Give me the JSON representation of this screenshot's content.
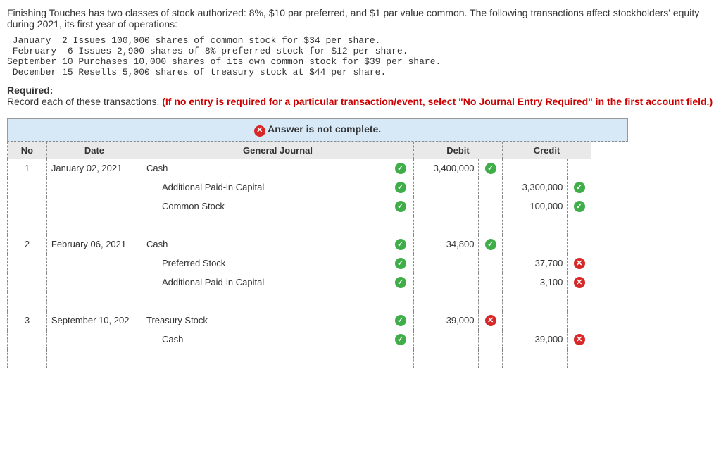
{
  "intro": "Finishing Touches has two classes of stock authorized: 8%, $10 par preferred, and $1 par value common. The following transactions affect stockholders' equity during 2021, its first year of operations:",
  "mono": " January  2 Issues 100,000 shares of common stock for $34 per share.\n February  6 Issues 2,900 shares of 8% preferred stock for $12 per share.\nSeptember 10 Purchases 10,000 shares of its own common stock for $39 per share.\n December 15 Resells 5,000 shares of treasury stock at $44 per share.",
  "required_label": "Required:",
  "required_text": "Record each of these transactions. ",
  "required_red": "(If no entry is required for a particular transaction/event, select \"No Journal Entry Required\" in the first account field.)",
  "banner": "Answer is not complete.",
  "banner_icon_alt": "✕",
  "th": {
    "no": "No",
    "date": "Date",
    "gj": "General Journal",
    "debit": "Debit",
    "credit": "Credit"
  },
  "rows": [
    {
      "no": "1",
      "date": "January 02, 2021",
      "acct": "Cash",
      "acct_ok": true,
      "debit": "3,400,000",
      "debit_ok": true,
      "credit": "",
      "credit_ok": null,
      "indent": false
    },
    {
      "no": "",
      "date": "",
      "acct": "Additional Paid-in Capital",
      "acct_ok": true,
      "debit": "",
      "debit_ok": null,
      "credit": "3,300,000",
      "credit_ok": true,
      "indent": true
    },
    {
      "no": "",
      "date": "",
      "acct": "Common Stock",
      "acct_ok": true,
      "debit": "",
      "debit_ok": null,
      "credit": "100,000",
      "credit_ok": true,
      "indent": true
    },
    {
      "blank": true
    },
    {
      "no": "2",
      "date": "February 06, 2021",
      "acct": "Cash",
      "acct_ok": true,
      "debit": "34,800",
      "debit_ok": true,
      "credit": "",
      "credit_ok": null,
      "indent": false
    },
    {
      "no": "",
      "date": "",
      "acct": "Preferred Stock",
      "acct_ok": true,
      "debit": "",
      "debit_ok": null,
      "credit": "37,700",
      "credit_ok": false,
      "indent": true
    },
    {
      "no": "",
      "date": "",
      "acct": "Additional Paid-in Capital",
      "acct_ok": true,
      "debit": "",
      "debit_ok": null,
      "credit": "3,100",
      "credit_ok": false,
      "indent": true
    },
    {
      "blank": true
    },
    {
      "no": "3",
      "date": "September 10, 202",
      "acct": "Treasury Stock",
      "acct_ok": true,
      "debit": "39,000",
      "debit_ok": false,
      "credit": "",
      "credit_ok": null,
      "indent": false,
      "date_truncated": true
    },
    {
      "no": "",
      "date": "",
      "acct": "Cash",
      "acct_ok": true,
      "debit": "",
      "debit_ok": null,
      "credit": "39,000",
      "credit_ok": false,
      "indent": true
    },
    {
      "blank": true
    }
  ]
}
